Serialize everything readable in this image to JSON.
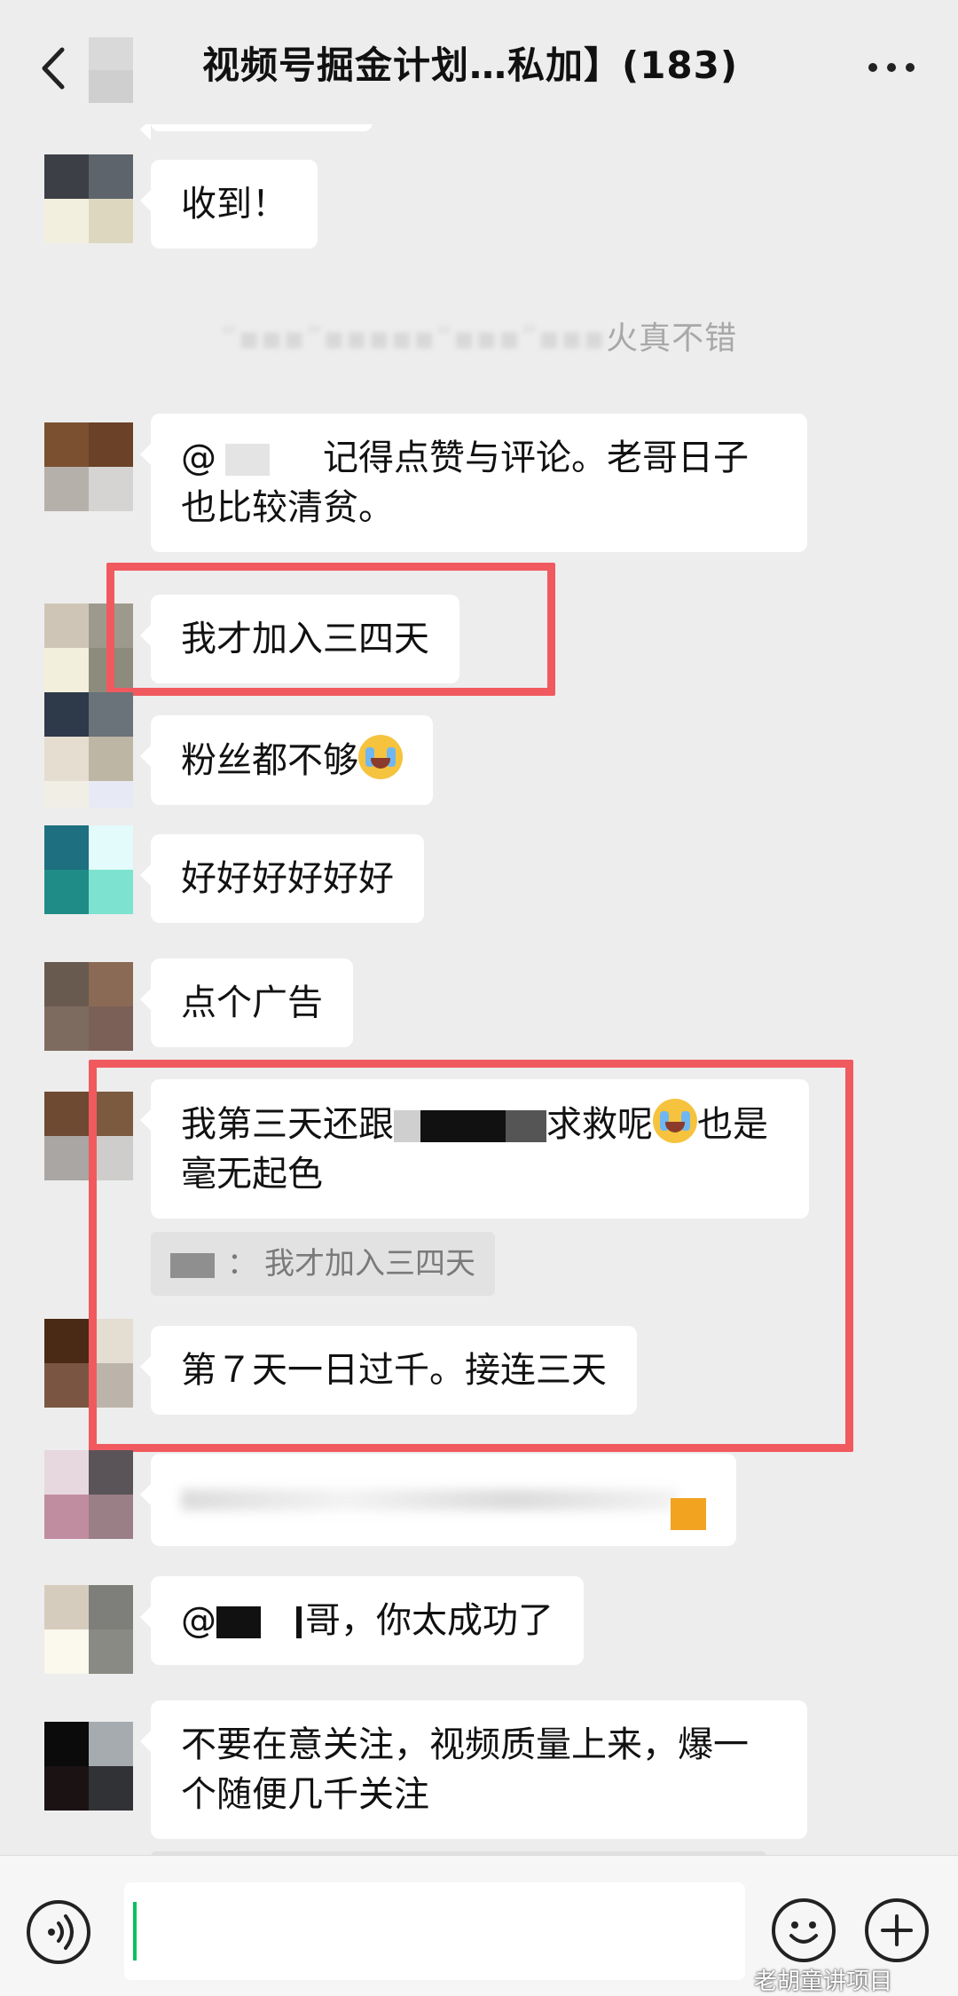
{
  "header": {
    "title": "视频号掘金计划…私加】(183)"
  },
  "messages": [
    {
      "text": "收到！"
    },
    {
      "system": "火真不错"
    },
    {
      "mention": "@",
      "text": "记得点赞与评论。老哥日子也比较清贫。"
    },
    {
      "text": "我才加入三四天"
    },
    {
      "text": "粉丝都不够"
    },
    {
      "text": "好好好好好好"
    },
    {
      "text": "点个广告"
    },
    {
      "text_a": "我第三天还跟",
      "text_b": "求救呢",
      "text_c": "也是毫无起色"
    },
    {
      "quote_sep": "：",
      "quote_text": "我才加入三四天"
    },
    {
      "text": "第７天一日过千。接连三天"
    },
    {
      "mention": "@",
      "text": "哥，你太成功了"
    },
    {
      "text": "不要在意关注，视频质量上来，爆一个随便几千关注"
    }
  ],
  "watermark": "老胡童讲项目",
  "colors": {
    "highlight": "#f05a5f",
    "accent": "#07c160"
  },
  "icons": [
    "back-icon",
    "more-icon",
    "voice-icon",
    "emoji-icon",
    "plus-icon",
    "cry-emoji"
  ]
}
